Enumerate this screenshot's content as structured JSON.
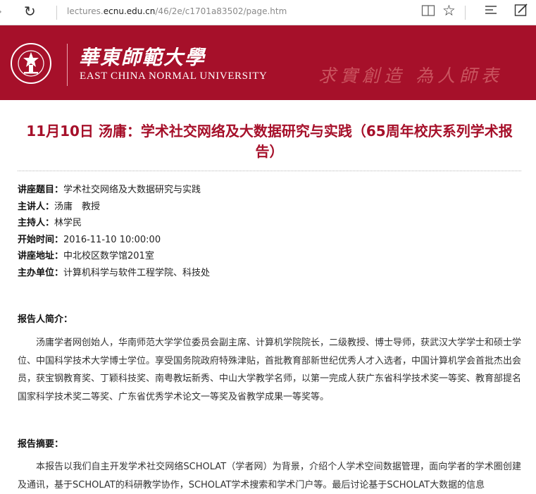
{
  "browser": {
    "forward_glyph": "›",
    "refresh_glyph": "↻",
    "url_prefix": "lectures.",
    "url_host": "ecnu.edu.cn",
    "url_path": "/46/2e/c1701a83502/page.htm",
    "icons": [
      "reading-view-icon",
      "favorite-star-icon",
      "hub-icon",
      "web-note-icon"
    ]
  },
  "header": {
    "cn_name": "華東師範大學",
    "en_name": "EAST CHINA NORMAL UNIVERSITY",
    "motto": "求實創造 為人師表",
    "brand_color": "#a6102a"
  },
  "article": {
    "title": "11月10日 汤庸：学术社交网络及大数据研究与实践（65周年校庆系列学术报告）",
    "meta": [
      {
        "label": "讲座题目：",
        "value": "学术社交网络及大数据研究与实践"
      },
      {
        "label": "主讲人：",
        "value": "汤庸　教授"
      },
      {
        "label": "主持人：",
        "value": "林学民"
      },
      {
        "label": "开始时间：",
        "value": "2016-11-10 10:00:00"
      },
      {
        "label": "讲座地址：",
        "value": "中北校区数学馆201室"
      },
      {
        "label": "主办单位：",
        "value": "计算机科学与软件工程学院、科技处"
      }
    ],
    "bio_heading": "报告人简介：",
    "bio_text": "汤庸学者网创始人，华南师范大学学位委员会副主席、计算机学院院长，二级教授、博士导师，获武汉大学学士和硕士学位、中国科学技术大学博士学位。享受国务院政府特殊津贴，首批教育部新世纪优秀人才入选者，中国计算机学会首批杰出会员，获宝钢教育奖、丁颖科技奖、南粤教坛新秀、中山大学教学名师，以第一完成人获广东省科学技术奖一等奖、教育部提名国家科学技术奖二等奖、广东省优秀学术论文一等奖及省教学成果一等奖等。",
    "abstract_heading": "报告摘要：",
    "abstract_text": "本报告以我们自主开发学术社交网络SCHOLAT（学者网）为背景，介绍个人学术空间数据管理，面向学者的学术圈创建及通讯，基于SCHOLAT的科研教学协作，SCHOLAT学术搜索和学术门户等。最后讨论基于SCHOLAT大数据的信息"
  }
}
